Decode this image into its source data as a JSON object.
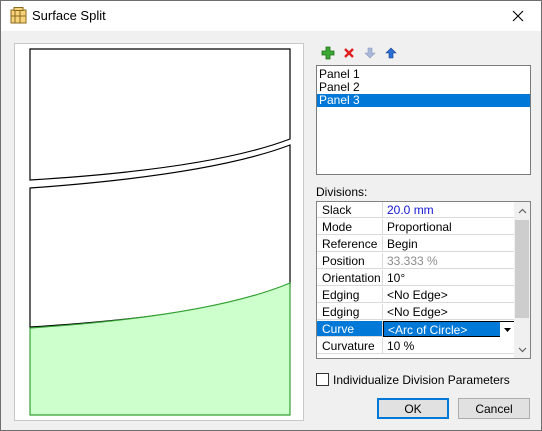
{
  "window": {
    "title": "Surface Split"
  },
  "toolbar": {
    "add": "add-icon",
    "delete": "delete-icon",
    "move_down": "move-down-icon",
    "move_up": "move-up-icon"
  },
  "panels": [
    {
      "label": "Panel 1",
      "selected": false
    },
    {
      "label": "Panel 2",
      "selected": false
    },
    {
      "label": "Panel 3",
      "selected": true
    }
  ],
  "divisions": {
    "label": "Divisions:",
    "rows": [
      {
        "name": "Slack",
        "value": "20.0 mm",
        "value_color": "#1515d4"
      },
      {
        "name": "Mode",
        "value": "Proportional"
      },
      {
        "name": "Reference",
        "value": "Begin"
      },
      {
        "name": "Position",
        "value": "33.333 %",
        "value_color": "#8c8c8c"
      },
      {
        "name": "Orientation",
        "value": "10°"
      },
      {
        "name": "Edging",
        "value": "<No Edge>"
      },
      {
        "name": "Edging",
        "value": "<No Edge>"
      },
      {
        "name": "Curve",
        "value": "<Arc of Circle>",
        "selected": true,
        "dropdown": true
      },
      {
        "name": "Curvature",
        "value": "10 %"
      }
    ]
  },
  "individualize": {
    "label": "Individualize Division Parameters",
    "checked": false
  },
  "buttons": {
    "ok": "OK",
    "cancel": "Cancel"
  },
  "colors": {
    "selection": "#0078d7",
    "selected_panel_fill": "#ccffcc",
    "selected_panel_stroke": "#33a033"
  }
}
